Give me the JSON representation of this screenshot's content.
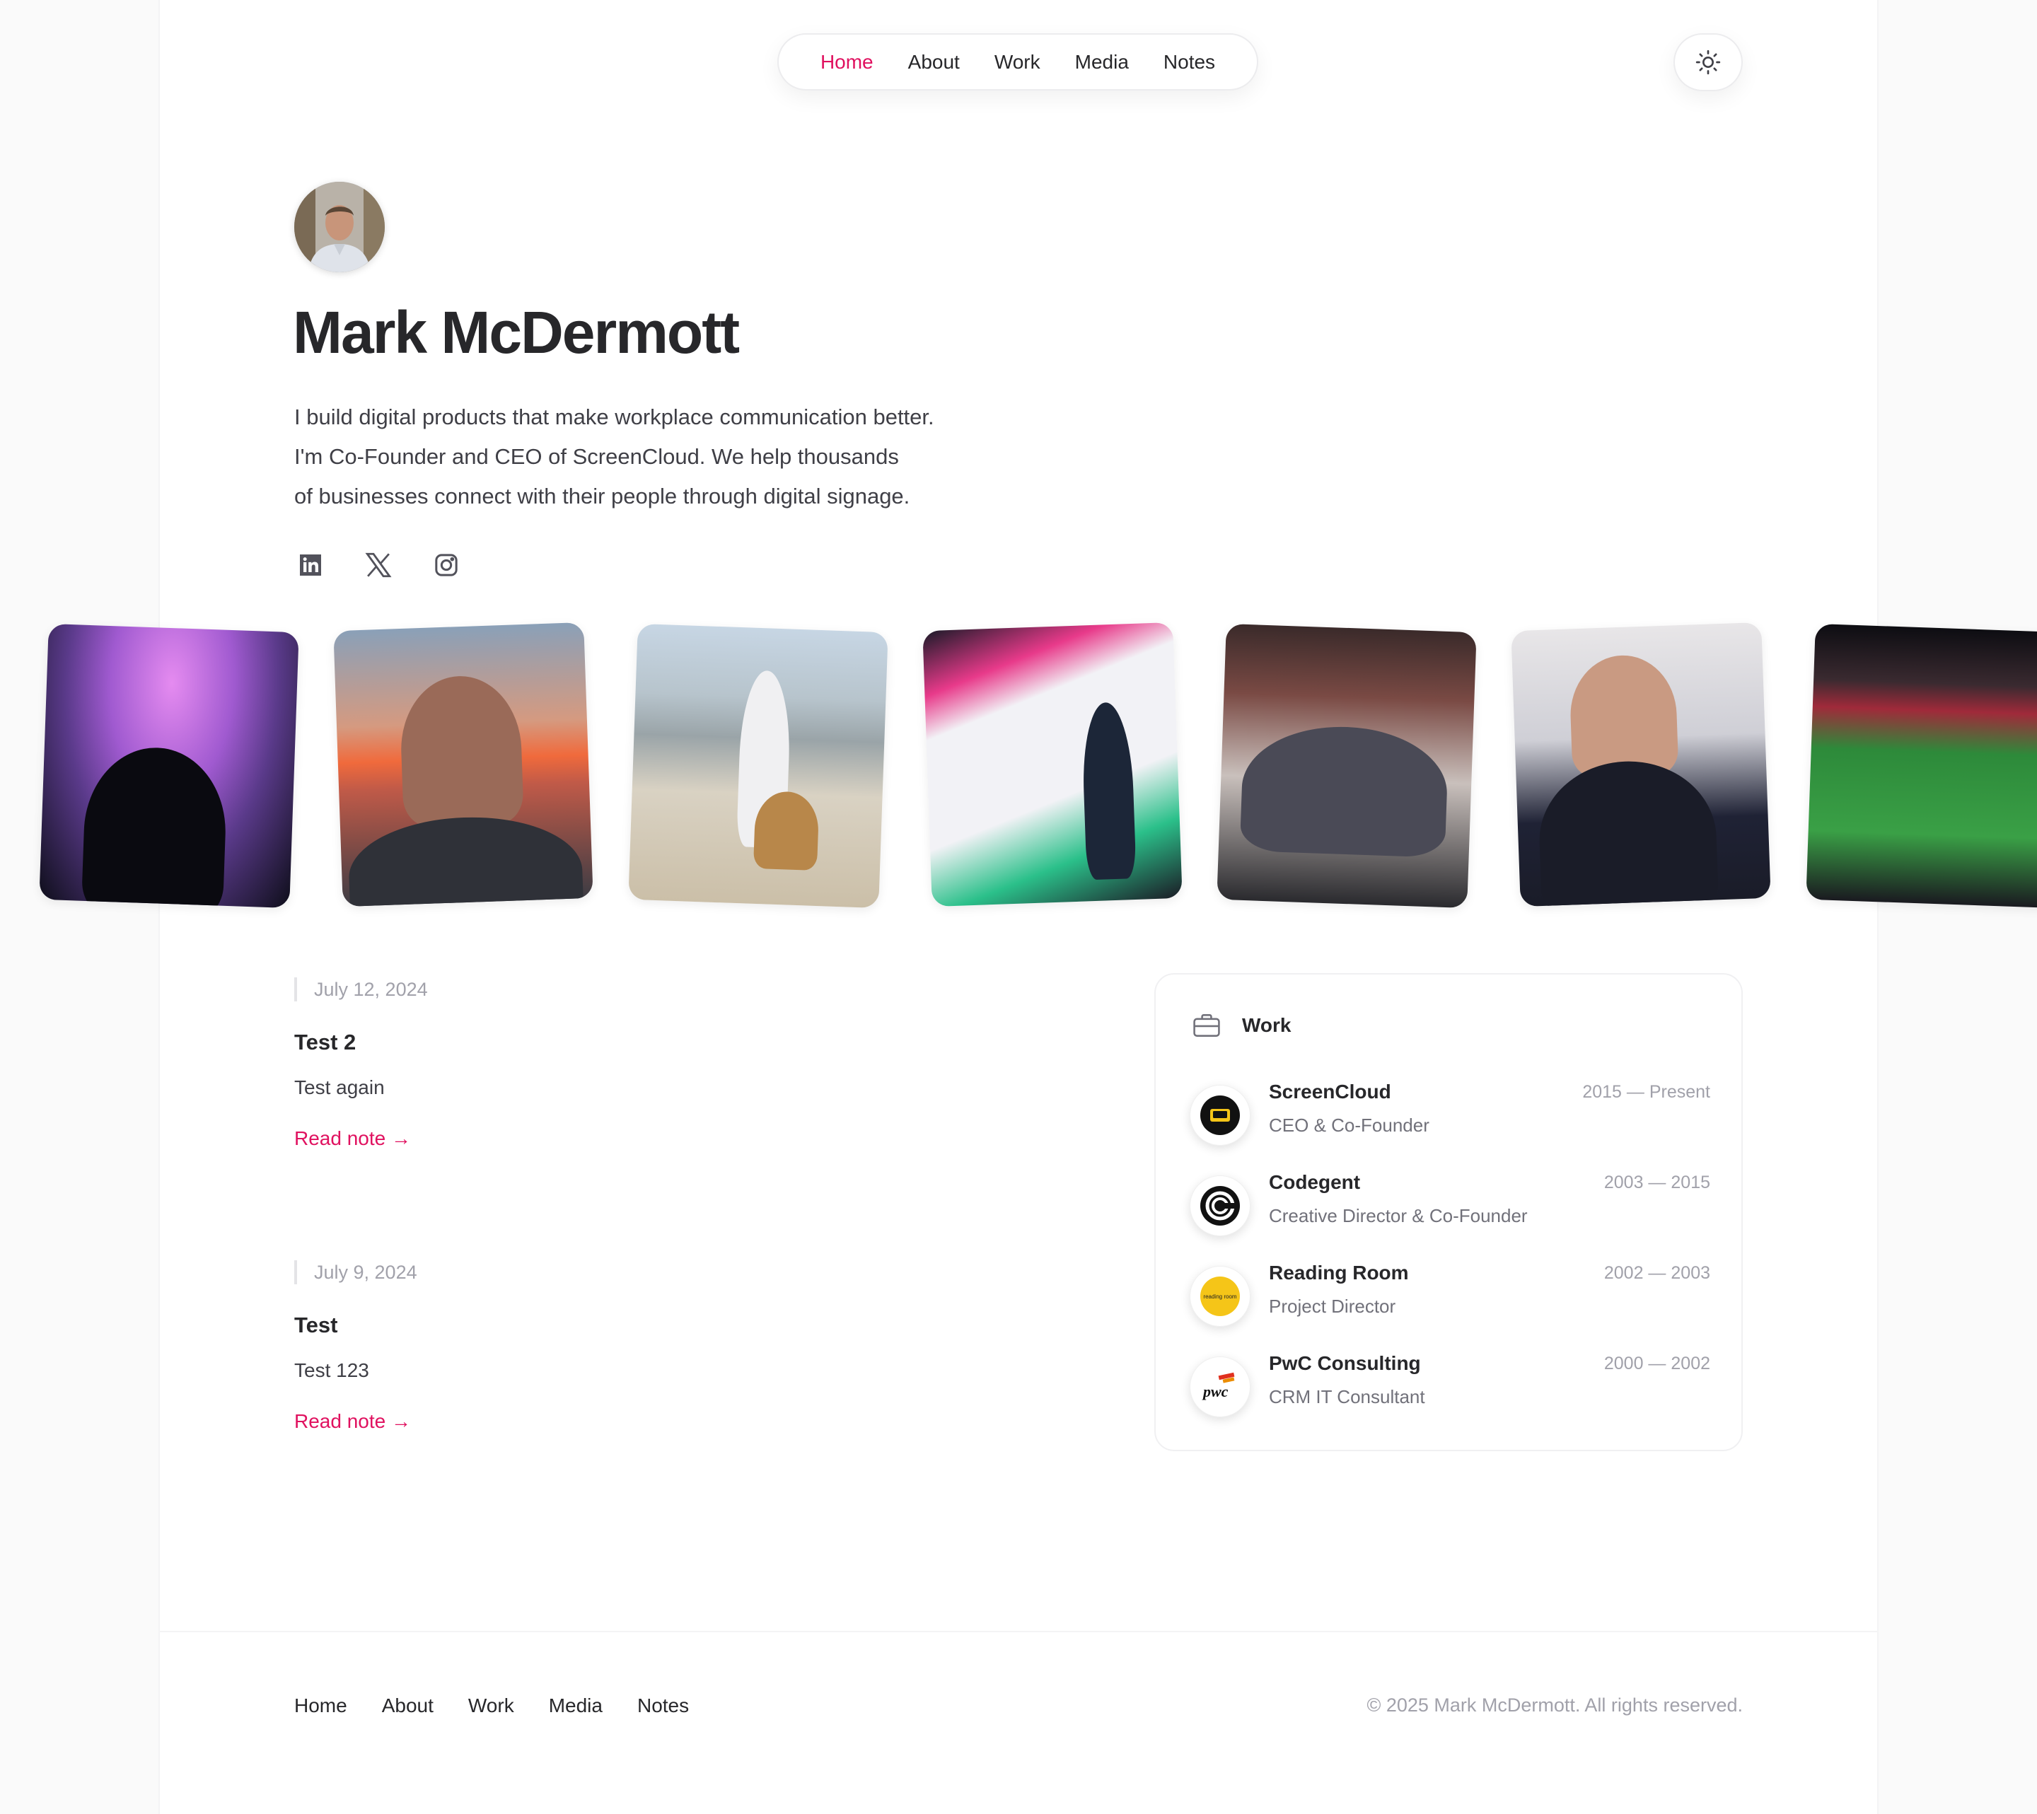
{
  "nav": {
    "items": [
      {
        "label": "Home",
        "active": true
      },
      {
        "label": "About",
        "active": false
      },
      {
        "label": "Work",
        "active": false
      },
      {
        "label": "Media",
        "active": false
      },
      {
        "label": "Notes",
        "active": false
      }
    ],
    "theme_toggle_icon": "sun-icon"
  },
  "hero": {
    "name": "Mark McDermott",
    "bio_lines": [
      "I build digital products that make workplace communication better.",
      "I'm Co-Founder and CEO of ScreenCloud. We help thousands",
      "of businesses connect with their people through digital signage."
    ],
    "socials": [
      "linkedin-icon",
      "x-icon",
      "instagram-icon"
    ]
  },
  "gallery": [
    "aurora-photo",
    "sunset-selfie-photo",
    "beach-dog-photo",
    "ucl-talk-photo",
    "gym-group-photo",
    "laughing-photo",
    "stadium-photo"
  ],
  "notes": [
    {
      "date": "July 12, 2024",
      "title": "Test 2",
      "description": "Test again",
      "link": "Read note →"
    },
    {
      "date": "July 9, 2024",
      "title": "Test",
      "description": "Test 123",
      "link": "Read note →"
    }
  ],
  "work": {
    "heading": "Work",
    "jobs": [
      {
        "company": "ScreenCloud",
        "role": "CEO & Co-Founder",
        "dates": "2015 — Present"
      },
      {
        "company": "Codegent",
        "role": "Creative Director & Co-Founder",
        "dates": "2003 — 2015"
      },
      {
        "company": "Reading Room",
        "role": "Project Director",
        "dates": "2002 — 2003",
        "logo_text": "reading room"
      },
      {
        "company": "PwC Consulting",
        "role": "CRM IT Consultant",
        "dates": "2000 — 2002",
        "logo_text": "pwc"
      }
    ]
  },
  "footer": {
    "nav": [
      "Home",
      "About",
      "Work",
      "Media",
      "Notes"
    ],
    "copyright": "© 2025 Mark McDermott. All rights reserved."
  },
  "colors": {
    "accent": "#e0115f",
    "text": "#27272a",
    "muted": "#a1a1aa",
    "background": "#fafafa"
  }
}
